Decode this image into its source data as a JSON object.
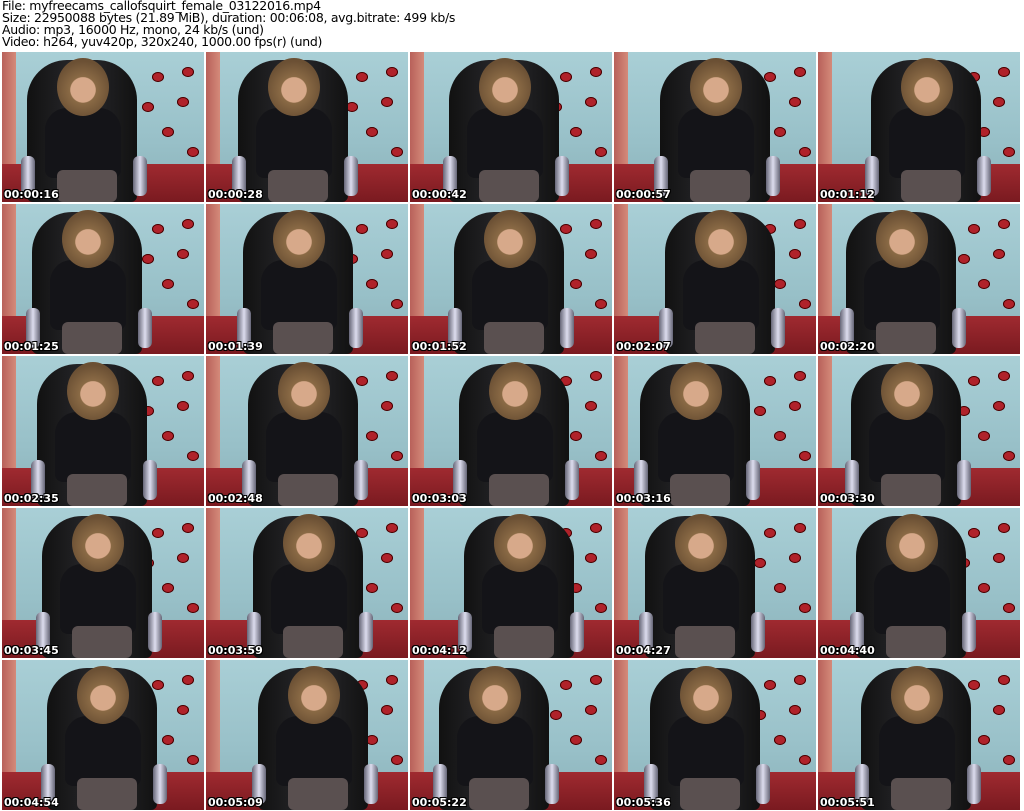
{
  "info": {
    "file": "File: myfreecams_callofsquirt_female_03122016.mp4",
    "size": "Size: 22950088 bytes (21.89 MiB), duration: 00:06:08, avg.bitrate: 499 kb/s",
    "audio": "Audio: mp3, 16000 Hz, mono, 24 kb/s (und)",
    "video": "Video: h264, yuv420p, 320x240, 1000.00 fps(r) (und)"
  },
  "thumbnails": [
    {
      "timestamp": "00:00:16"
    },
    {
      "timestamp": "00:00:28"
    },
    {
      "timestamp": "00:00:42"
    },
    {
      "timestamp": "00:00:57"
    },
    {
      "timestamp": "00:01:12"
    },
    {
      "timestamp": "00:01:25"
    },
    {
      "timestamp": "00:01:39"
    },
    {
      "timestamp": "00:01:52"
    },
    {
      "timestamp": "00:02:07"
    },
    {
      "timestamp": "00:02:20"
    },
    {
      "timestamp": "00:02:35"
    },
    {
      "timestamp": "00:02:48"
    },
    {
      "timestamp": "00:03:03"
    },
    {
      "timestamp": "00:03:16"
    },
    {
      "timestamp": "00:03:30"
    },
    {
      "timestamp": "00:03:45"
    },
    {
      "timestamp": "00:03:59"
    },
    {
      "timestamp": "00:04:12"
    },
    {
      "timestamp": "00:04:27"
    },
    {
      "timestamp": "00:04:40"
    },
    {
      "timestamp": "00:04:54"
    },
    {
      "timestamp": "00:05:09"
    },
    {
      "timestamp": "00:05:22"
    },
    {
      "timestamp": "00:05:36"
    },
    {
      "timestamp": "00:05:51"
    }
  ]
}
